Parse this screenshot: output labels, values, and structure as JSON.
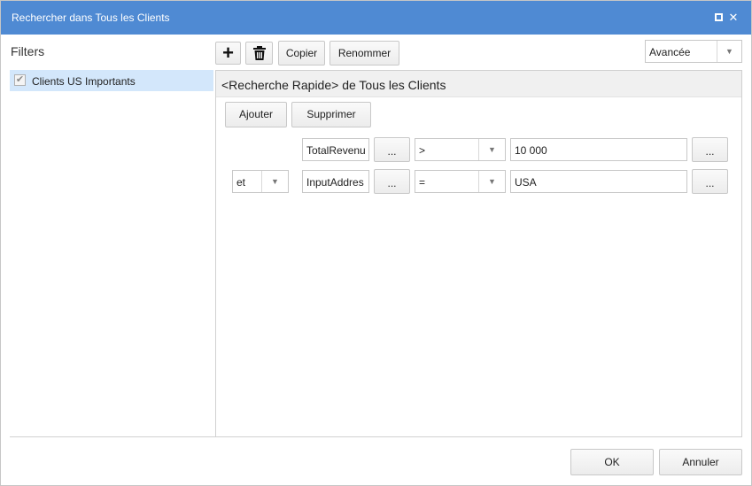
{
  "window": {
    "title": "Rechercher dans Tous les Clients",
    "maximize_icon": "maximize-icon",
    "close_glyph": "✕"
  },
  "sidebar": {
    "label": "Filters",
    "items": [
      {
        "label": "Clients US Importants",
        "checked": true,
        "check_glyph": "✔"
      }
    ]
  },
  "toolbar": {
    "add_icon": "plus-icon",
    "add_glyph": "+",
    "delete_icon": "trash-icon",
    "copy_label": "Copier",
    "rename_label": "Renommer",
    "mode": {
      "value": "Avancée",
      "arrow": "▼"
    }
  },
  "editor": {
    "header": "<Recherche Rapide> de Tous les Clients",
    "add_label": "Ajouter",
    "remove_label": "Supprimer",
    "conditions": [
      {
        "connector": "",
        "field": "TotalRevenu",
        "field_btn": "...",
        "operator": ">",
        "value": "10 000",
        "value_btn": "..."
      },
      {
        "connector": "et",
        "field": "InputAddres",
        "field_btn": "...",
        "operator": "=",
        "value": "USA",
        "value_btn": "..."
      }
    ],
    "dropdown_arrow": "▼"
  },
  "footer": {
    "ok_label": "OK",
    "cancel_label": "Annuler"
  }
}
